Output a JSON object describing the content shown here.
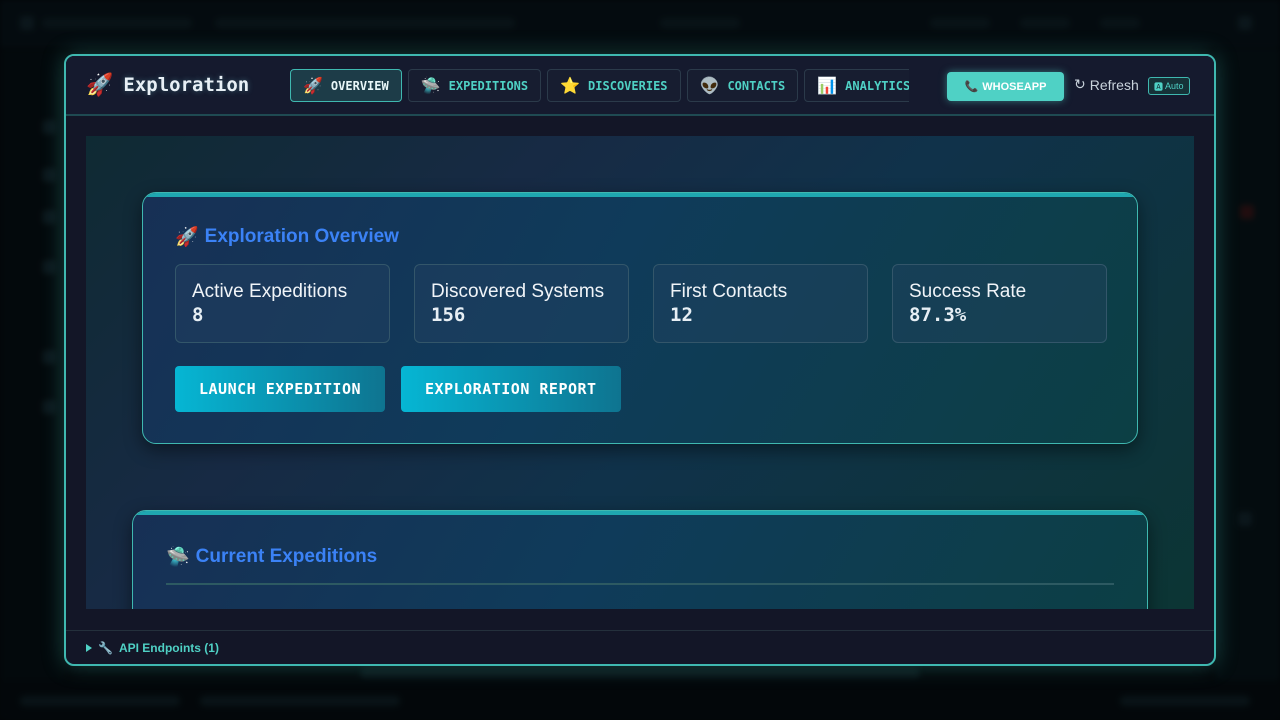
{
  "modal": {
    "title": "Exploration",
    "title_icon": "🚀",
    "tabs": [
      {
        "icon": "🚀",
        "label": "OVERVIEW",
        "active": true
      },
      {
        "icon": "🛸",
        "label": "EXPEDITIONS",
        "active": false
      },
      {
        "icon": "⭐",
        "label": "DISCOVERIES",
        "active": false
      },
      {
        "icon": "👽",
        "label": "CONTACTS",
        "active": false
      },
      {
        "icon": "📊",
        "label": "ANALYTICS",
        "active": false
      }
    ],
    "whoseapp_icon": "📞",
    "whoseapp_label": "WHOSEAPP",
    "refresh_icon": "↻",
    "refresh_label": "Refresh",
    "auto_icon": "🅰",
    "auto_label": "Auto"
  },
  "overview": {
    "title_icon": "🚀",
    "title": "Exploration Overview",
    "stats": [
      {
        "label": "Active Expeditions",
        "value": "8"
      },
      {
        "label": "Discovered Systems",
        "value": "156"
      },
      {
        "label": "First Contacts",
        "value": "12"
      },
      {
        "label": "Success Rate",
        "value": "87.3%"
      }
    ],
    "actions": [
      "LAUNCH EXPEDITION",
      "EXPLORATION REPORT"
    ]
  },
  "expeditions": {
    "title_icon": "🛸",
    "title": "Current Expeditions"
  },
  "footer": {
    "api_icon": "🔧",
    "api_label": "API Endpoints (1)"
  },
  "colors": {
    "accent": "#4fd1c5",
    "border": "#3fb8b0",
    "heading": "#3b82f6",
    "button": "#06b6d4"
  }
}
